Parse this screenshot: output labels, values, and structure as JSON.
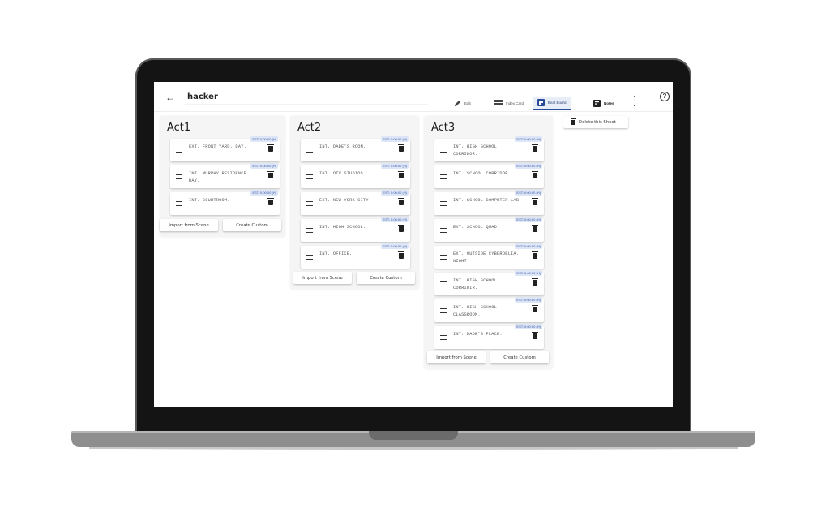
{
  "app": {
    "title": "hacker",
    "back_icon": "arrow-left-icon"
  },
  "tabs": [
    {
      "label": "Edit",
      "icon": "pencil-icon"
    },
    {
      "label": "Index Card",
      "icon": "index-card-icon"
    },
    {
      "label": "Beat Board",
      "icon": "beat-board-icon",
      "active": true
    },
    {
      "label": "Notes",
      "icon": "notes-icon"
    }
  ],
  "toolbar": {
    "more_icon": "more-vertical-icon",
    "help_icon": "help-icon",
    "help_glyph": "?"
  },
  "delete_sheet_label": "Delete this Sheet",
  "acts": [
    {
      "title": "Act1",
      "cards": [
        {
          "scene": "EXT. FRONT YARD. DAY.",
          "est": "EST: 0:00:00 (H)"
        },
        {
          "scene": "INT. MURPHY RESIDENCE. DAY.",
          "est": "EST: 0:00:00 (H)"
        },
        {
          "scene": "INT. COURTROOM.",
          "est": "EST: 0:00:00 (H)"
        }
      ],
      "import_label": "Import from Scene",
      "custom_label": "Create Custom"
    },
    {
      "title": "Act2",
      "cards": [
        {
          "scene": "INT. DADE'S ROOM.",
          "est": "EST: 0:00:00 (H)"
        },
        {
          "scene": "INT. OTV STUDIOS.",
          "est": "EST: 0:00:00 (H)"
        },
        {
          "scene": "EXT. NEW YORK CITY.",
          "est": "EST: 0:00:00 (H)"
        },
        {
          "scene": "INT. HIGH SCHOOL.",
          "est": "EST: 0:00:00 (H)"
        },
        {
          "scene": "INT. OFFICE.",
          "est": "EST: 0:00:00 (H)"
        }
      ],
      "import_label": "Import from Scene",
      "custom_label": "Create Custom"
    },
    {
      "title": "Act3",
      "cards": [
        {
          "scene": "INT. HIGH SCHOOL CORRIDOR.",
          "est": "EST: 0:00:00 (H)"
        },
        {
          "scene": "INT. SCHOOL CORRIDOR.",
          "est": "EST: 0:00:00 (H)"
        },
        {
          "scene": "INT. SCHOOL COMPUTER LAB.",
          "est": "EST: 0:00:00 (H)"
        },
        {
          "scene": "EXT. SCHOOL QUAD.",
          "est": "EST: 0:00:00 (H)"
        },
        {
          "scene": "EXT. OUTSIDE CYBERDELIA. NIGHT.",
          "est": "EST: 0:00:00 (H)"
        },
        {
          "scene": "INT. HIGH SCHOOL CORRIDIR.",
          "est": "EST: 0:00:00 (H)"
        },
        {
          "scene": "INT. HIGH SCHOOL CLASSROOM.",
          "est": "EST: 0:00:00 (H)"
        },
        {
          "scene": "INT. DADE'S PLACE.",
          "est": "EST: 0:00:00 (H)"
        }
      ],
      "import_label": "Import from Scene",
      "custom_label": "Create Custom"
    }
  ],
  "colors": {
    "accent": "#2a4a9a",
    "est_bg": "#dde6f6"
  }
}
